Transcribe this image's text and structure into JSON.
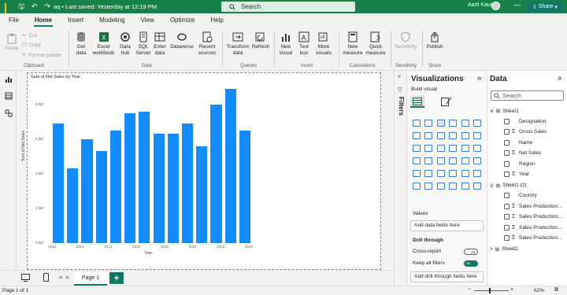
{
  "titlebar": {
    "doc_title": "aq • Last saved: Yesterday at 12:19 PM",
    "search_placeholder": "Search",
    "user_name": "Aarti Kaushik",
    "minimize": "—",
    "maximize": "☐",
    "close": "✕"
  },
  "menu": {
    "tabs": [
      "File",
      "Home",
      "Insert",
      "Modeling",
      "View",
      "Optimize",
      "Help"
    ],
    "active": "Home",
    "share_label": "Share"
  },
  "ribbon": {
    "clipboard": {
      "paste": "Paste",
      "cut": "Cut",
      "copy": "Copy",
      "format_painter": "Format painter",
      "group": "Clipboard"
    },
    "data": {
      "get_data": "Get data",
      "excel": "Excel workbook",
      "data_hub": "Data hub",
      "sql": "SQL Server",
      "enter_data": "Enter data",
      "dataverse": "Dataverse",
      "recent": "Recent sources",
      "group": "Data"
    },
    "queries": {
      "transform": "Transform data",
      "refresh": "Refresh",
      "group": "Queries"
    },
    "insert": {
      "new_visual": "New visual",
      "text_box": "Text box",
      "more_visuals": "More visuals",
      "group": "Insert"
    },
    "calculations": {
      "new_measure": "New measure",
      "quick_measure": "Quick measure",
      "group": "Calculations"
    },
    "sensitivity": {
      "label": "Sensitivity",
      "group": "Sensitivity"
    },
    "share": {
      "publish": "Publish",
      "group": "Share"
    }
  },
  "chart_data": {
    "type": "bar",
    "title": "Sum of Net Sales by Year",
    "xlabel": "Year",
    "ylabel": "Sum of Net Sales",
    "categories": [
      "2011",
      "2012",
      "2013",
      "2014",
      "2015",
      "2016",
      "2017",
      "2018",
      "2019",
      "2020",
      "2021",
      "2022",
      "2023",
      "2024"
    ],
    "values": [
      6.9,
      4.3,
      6.0,
      5.3,
      6.5,
      7.5,
      7.6,
      6.3,
      6.3,
      6.9,
      5.6,
      8.0,
      8.9,
      6.5
    ],
    "x_tick_labels": [
      "2010",
      "2012",
      "2014",
      "2016",
      "2018",
      "2020",
      "2022",
      "2024"
    ],
    "y_tick_labels": [
      "0.0M",
      "2.0M",
      "4.0M",
      "6.0M",
      "8.0M"
    ],
    "ylim": [
      0,
      9.5
    ],
    "bar_color": "#118dff",
    "grid": false,
    "legend": "none"
  },
  "pages": {
    "tab": "Page 1",
    "add": "+"
  },
  "status": {
    "page": "Page 1 of 1",
    "zoom": "62%"
  },
  "filters": {
    "label": "Filters"
  },
  "visualizations": {
    "title": "Visualizations",
    "build_visual": "Build visual",
    "values_label": "Values",
    "values_placeholder": "Add data fields here",
    "drill_through": "Drill through",
    "cross_report": "Cross-report",
    "cross_report_state": "Off",
    "keep_filters": "Keep all filters",
    "keep_filters_state": "On",
    "drill_placeholder": "Add drill-through fields here"
  },
  "data": {
    "title": "Data",
    "search_placeholder": "Search",
    "tables": [
      {
        "name": "Sheet1",
        "fields": [
          {
            "name": "Designation",
            "sigma": false
          },
          {
            "name": "Gross Sales",
            "sigma": true
          },
          {
            "name": "Name",
            "sigma": false
          },
          {
            "name": "Net Sales",
            "sigma": true
          },
          {
            "name": "Region",
            "sigma": false
          },
          {
            "name": "Year",
            "sigma": true
          }
        ]
      },
      {
        "name": "Sheet1 (2)",
        "fields": [
          {
            "name": "Country",
            "sigma": false
          },
          {
            "name": "Sales Production...",
            "sigma": true
          },
          {
            "name": "Sales Production...",
            "sigma": true
          },
          {
            "name": "Sales Production...",
            "sigma": true
          },
          {
            "name": "Sales Production...",
            "sigma": true
          }
        ]
      },
      {
        "name": "Sheet2",
        "fields": []
      }
    ]
  }
}
